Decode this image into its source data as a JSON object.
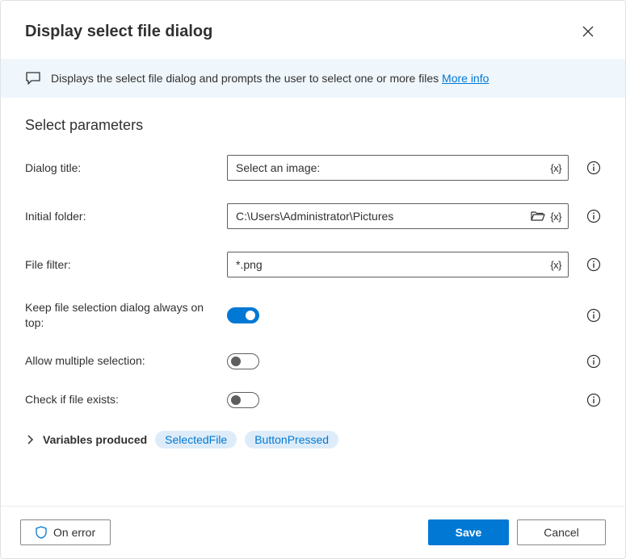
{
  "header": {
    "title": "Display select file dialog"
  },
  "banner": {
    "text": "Displays the select file dialog and prompts the user to select one or more files ",
    "link": "More info"
  },
  "section": {
    "heading": "Select parameters"
  },
  "fields": {
    "dialog_title": {
      "label": "Dialog title:",
      "value": "Select an image:"
    },
    "initial_folder": {
      "label": "Initial folder:",
      "value": "C:\\Users\\Administrator\\Pictures"
    },
    "file_filter": {
      "label": "File filter:",
      "value": "*.png"
    },
    "always_on_top": {
      "label": "Keep file selection dialog always on top:",
      "on": true
    },
    "allow_multiple": {
      "label": "Allow multiple selection:",
      "on": false
    },
    "check_exists": {
      "label": "Check if file exists:",
      "on": false
    }
  },
  "variables": {
    "label": "Variables produced",
    "chips": [
      "SelectedFile",
      "ButtonPressed"
    ]
  },
  "footer": {
    "on_error": "On error",
    "save": "Save",
    "cancel": "Cancel"
  },
  "var_token": "{x}"
}
